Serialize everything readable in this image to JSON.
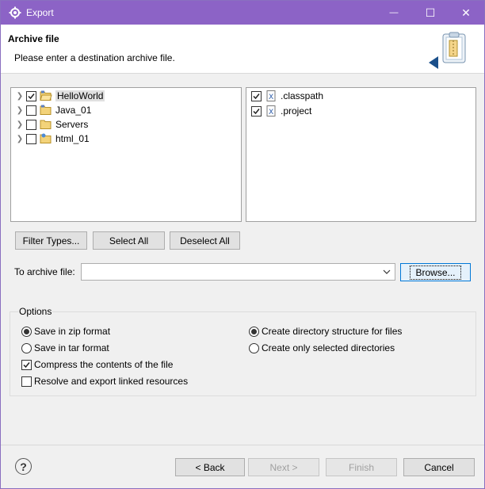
{
  "window": {
    "title": "Export",
    "minimize_glyph": "—",
    "maximize_glyph": "☐",
    "close_glyph": "✕"
  },
  "banner": {
    "heading": "Archive file",
    "description": "Please enter a destination archive file."
  },
  "left_tree": {
    "items": [
      {
        "label": "HelloWorld",
        "checked": true,
        "selected": true,
        "icon": "open-folder-icon"
      },
      {
        "label": "Java_01",
        "checked": false,
        "selected": false,
        "icon": "project-folder-icon"
      },
      {
        "label": "Servers",
        "checked": false,
        "selected": false,
        "icon": "folder-icon"
      },
      {
        "label": "html_01",
        "checked": false,
        "selected": false,
        "icon": "web-project-icon"
      }
    ]
  },
  "right_list": {
    "items": [
      {
        "label": ".classpath",
        "checked": true,
        "icon": "xml-file-icon"
      },
      {
        "label": ".project",
        "checked": true,
        "icon": "xml-file-icon"
      }
    ]
  },
  "buttons": {
    "filter_types": "Filter Types...",
    "select_all": "Select All",
    "deselect_all": "Deselect All",
    "browse": "Browse...",
    "back": "< Back",
    "next": "Next >",
    "finish": "Finish",
    "cancel": "Cancel"
  },
  "archive": {
    "label": "To archive file:",
    "value": ""
  },
  "options": {
    "title": "Options",
    "save_zip": "Save in zip format",
    "save_tar": "Save in tar format",
    "compress": "Compress the contents of the file",
    "resolve_links": "Resolve and export linked resources",
    "create_dir_structure": "Create directory structure for files",
    "create_selected_dirs": "Create only selected directories"
  },
  "colors": {
    "titlebar": "#8c63c6",
    "focus_border": "#0078d7"
  }
}
